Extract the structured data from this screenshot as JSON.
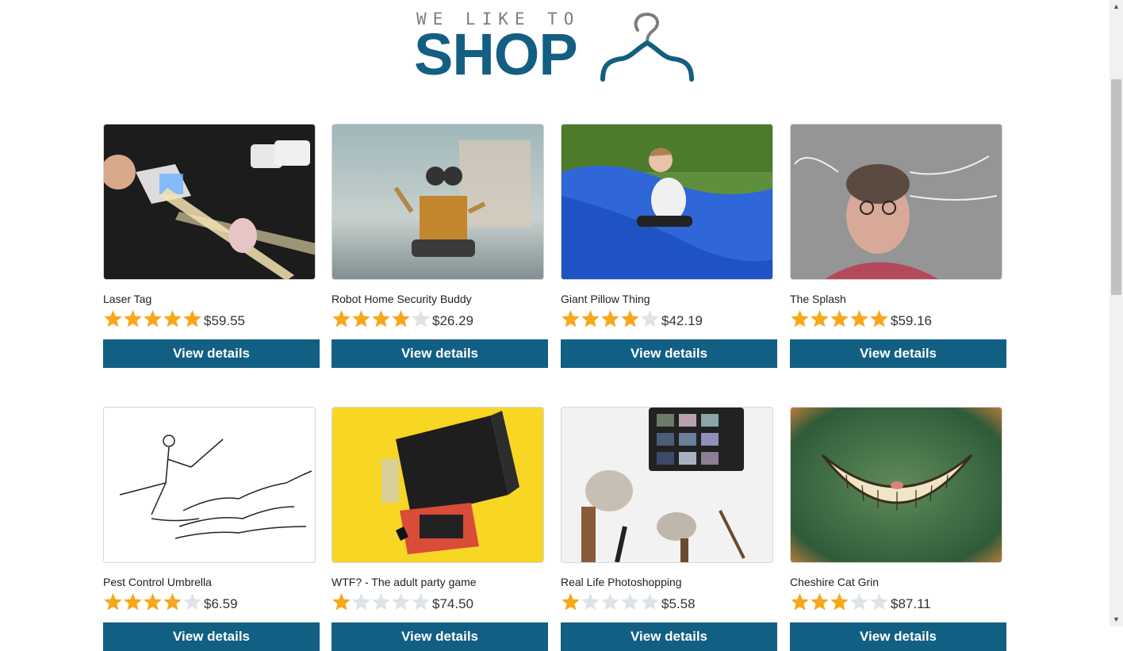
{
  "header": {
    "tagline": "WE LIKE TO",
    "word": "SHOP",
    "brand_color": "#135e82",
    "icon": "hanger-icon"
  },
  "products": [
    {
      "name": "Laser Tag",
      "price": "$59.55",
      "rating": 5,
      "button": "View details"
    },
    {
      "name": "Robot Home Security Buddy",
      "price": "$26.29",
      "rating": 4,
      "button": "View details"
    },
    {
      "name": "Giant Pillow Thing",
      "price": "$42.19",
      "rating": 4,
      "button": "View details"
    },
    {
      "name": "The Splash",
      "price": "$59.16",
      "rating": 5,
      "button": "View details"
    },
    {
      "name": "Pest Control Umbrella",
      "price": "$6.59",
      "rating": 4,
      "button": "View details"
    },
    {
      "name": "WTF? - The adult party game",
      "price": "$74.50",
      "rating": 1,
      "button": "View details"
    },
    {
      "name": "Real Life Photoshopping",
      "price": "$5.58",
      "rating": 1,
      "button": "View details"
    },
    {
      "name": "Cheshire Cat Grin",
      "price": "$87.11",
      "rating": 3,
      "button": "View details"
    }
  ],
  "colors": {
    "star_filled": "#f7a71b",
    "star_empty": "#dde3e8",
    "button_bg": "#125f84"
  }
}
